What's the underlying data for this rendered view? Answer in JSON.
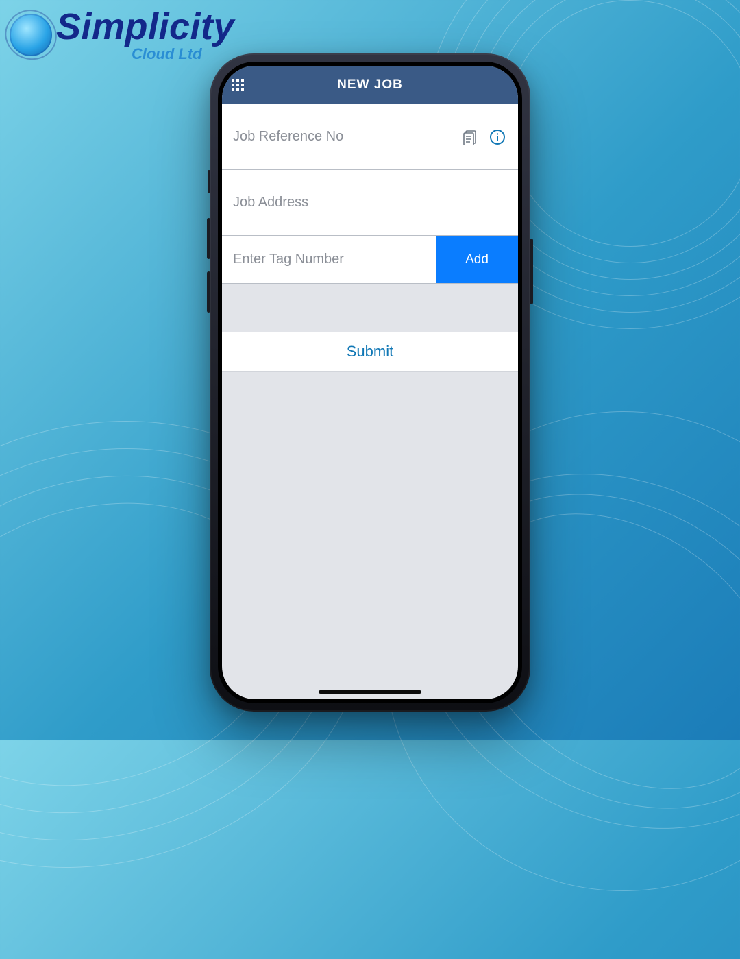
{
  "brand": {
    "title": "Simplicity",
    "subtitle": "Cloud Ltd"
  },
  "app": {
    "header_title": "NEW JOB",
    "job_ref_placeholder": "Job Reference No",
    "job_ref_value": "",
    "job_address_placeholder": "Job Address",
    "job_address_value": "",
    "tag_placeholder": "Enter Tag Number",
    "tag_value": "",
    "add_label": "Add",
    "submit_label": "Submit"
  },
  "colors": {
    "header_bg": "#3a5a86",
    "primary_blue": "#0a7dff",
    "link_blue": "#1077b5"
  }
}
